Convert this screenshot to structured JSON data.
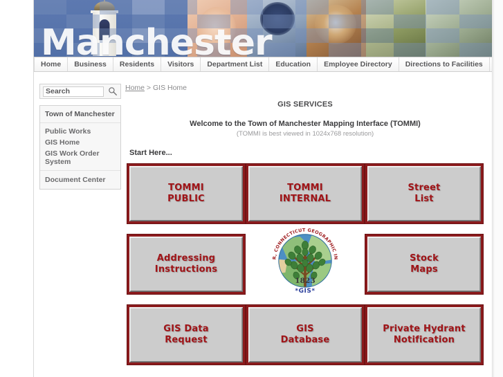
{
  "banner": {
    "title": "Manchester",
    "tower_icon": "church-tower-icon"
  },
  "nav": {
    "items": [
      {
        "label": "Home"
      },
      {
        "label": "Business"
      },
      {
        "label": "Residents"
      },
      {
        "label": "Visitors"
      },
      {
        "label": "Department List"
      },
      {
        "label": "Education"
      },
      {
        "label": "Employee Directory"
      },
      {
        "label": "Directions to Facilities"
      }
    ]
  },
  "sidebar": {
    "search": {
      "placeholder": "Search",
      "value": "",
      "icon": "magnifier-icon"
    },
    "box_header": "Town of Manchester",
    "links": [
      {
        "label": "Public Works"
      },
      {
        "label": "GIS Home"
      },
      {
        "label": "GIS Work Order System"
      }
    ],
    "footer_link": {
      "label": "Document Center"
    }
  },
  "main": {
    "breadcrumb": {
      "home": "Home",
      "separator": " > ",
      "current": "GIS Home"
    },
    "page_title": "GIS SERVICES",
    "welcome": "Welcome to the Town of Manchester Mapping Interface (TOMMI)",
    "welcome_sub": "(TOMMI is best viewed in 1024x768 resolution)",
    "start_here": "Start Here...",
    "buttons": [
      {
        "line1": "TOMMI",
        "line2": "PUBLIC"
      },
      {
        "line1": "TOMMI",
        "line2": "INTERNAL"
      },
      {
        "line1": "Street",
        "line2": "List"
      },
      {
        "line1": "Addressing",
        "line2": "Instructions"
      },
      {
        "line1": "Stock",
        "line2": "Maps"
      },
      {
        "line1": "GIS Data",
        "line2": "Request"
      },
      {
        "line1": "GIS",
        "line2": "Database"
      },
      {
        "line1": "Private Hydrant",
        "line2": "Notification"
      }
    ],
    "seal": {
      "arc_text": "TOWN OF MANCHESTER, CONNECTICUT  GEOGRAPHIC INFORMATION SERVICES",
      "year": "1823",
      "caption": "*GIS*"
    }
  },
  "colors": {
    "button_frame": "#8b1a1c",
    "button_text": "#a01418",
    "banner_sky": "#5a76ae",
    "seal_caption": "#2b3f9c"
  }
}
